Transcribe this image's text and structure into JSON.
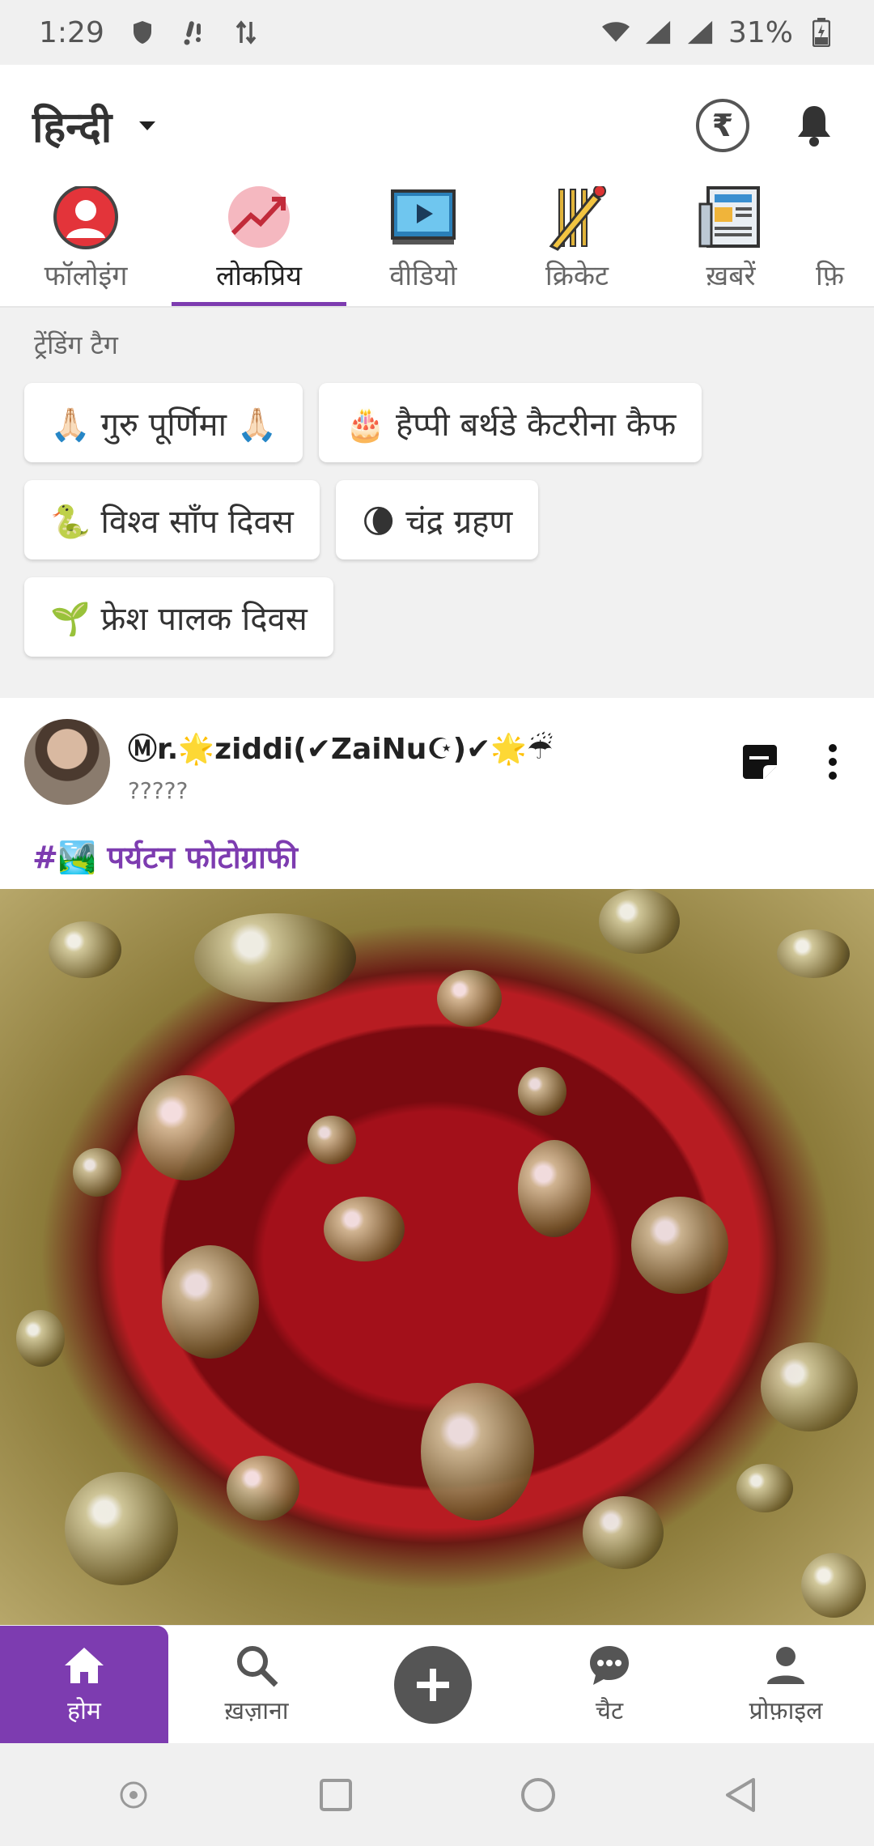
{
  "status_bar": {
    "time": "1:29",
    "battery": "31%"
  },
  "header": {
    "language": "हिन्दी"
  },
  "tabs": [
    {
      "label": "फॉलोइंग",
      "icon": "following-icon"
    },
    {
      "label": "लोकप्रिय",
      "icon": "trending-icon",
      "active": true
    },
    {
      "label": "वीडियो",
      "icon": "video-icon"
    },
    {
      "label": "क्रिकेट",
      "icon": "cricket-icon"
    },
    {
      "label": "ख़बरें",
      "icon": "news-icon"
    },
    {
      "label": "फ़ि",
      "icon": "film-icon"
    }
  ],
  "trending": {
    "title": "ट्रेंडिंग टैग",
    "tags": [
      "🙏🏻 गुरु पूर्णिमा 🙏🏻",
      "🎂 हैप्पी बर्थडे कैटरीना कैफ",
      "🐍 विश्व साँप दिवस",
      "🌘 चंद्र ग्रहण",
      "🌱 फ्रेश पालक दिवस"
    ]
  },
  "post": {
    "username": "Ⓜr.🌟ziddi(✔ZaiNu☪)✔🌟☔",
    "subtitle": "?????",
    "tag": "#🏞️ पर्यटन फोटोग्राफी"
  },
  "bottom_nav": {
    "home": "होम",
    "explore": "ख़ज़ाना",
    "chat": "चैट",
    "profile": "प्रोफ़ाइल"
  },
  "colors": {
    "accent": "#7d3cb0"
  }
}
